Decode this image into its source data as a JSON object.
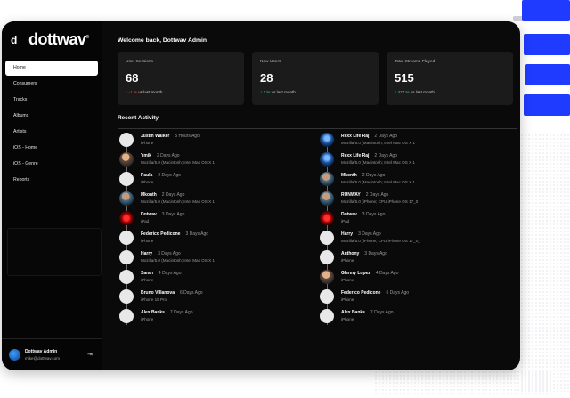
{
  "app": {
    "logo_text": "dottwav",
    "logo_mark": "d",
    "logo_reg": "®"
  },
  "sidebar": {
    "items": [
      {
        "label": "Home",
        "active": true
      },
      {
        "label": "Consumers"
      },
      {
        "label": "Tracks"
      },
      {
        "label": "Albums"
      },
      {
        "label": "Artists"
      },
      {
        "label": "iOS - Home"
      },
      {
        "label": "iOS - Genre"
      },
      {
        "label": "Reports"
      }
    ],
    "user": {
      "name": "Dottwav Admin",
      "email": "mike@dottwav.com",
      "logout_icon": "logout-icon"
    }
  },
  "main": {
    "welcome": "Welcome back, Dottwav Admin",
    "cards": [
      {
        "label": "User Sessions",
        "value": "68",
        "trend_arrow": "↓",
        "trend_value": "-1 %",
        "trend_text": "vs last month",
        "trend": "down"
      },
      {
        "label": "New Users",
        "value": "28",
        "trend_arrow": "↑",
        "trend_value": "1 %",
        "trend_text": "vs last month",
        "trend": "up"
      },
      {
        "label": "Total Streams Played",
        "value": "515",
        "trend_arrow": "↑",
        "trend_value": "477 %",
        "trend_text": "vs last month",
        "trend": "up"
      }
    ],
    "recent_title": "Recent Activity",
    "activity_left": [
      {
        "name": "Justin Walker",
        "time": "5 Hours Ago",
        "device": "iPhone",
        "avatar": "blank"
      },
      {
        "name": "Ymik",
        "time": "2 Days Ago",
        "device": "Mozilla/5.0 (Macintosh; Intel Mac OS X 1",
        "avatar": "photo"
      },
      {
        "name": "Paula",
        "time": "2 Days Ago",
        "device": "iPhone",
        "avatar": "blank"
      },
      {
        "name": "Mkonth",
        "time": "2 Days Ago",
        "device": "Mozilla/5.0 (Macintosh; Intel Mac OS X 1",
        "avatar": "photo2"
      },
      {
        "name": "Dotwav",
        "time": "3 Days Ago",
        "device": "iPad",
        "avatar": "red"
      },
      {
        "name": "Federico Pedicone",
        "time": "3 Days Ago",
        "device": "iPhone",
        "avatar": "blank"
      },
      {
        "name": "Harry",
        "time": "3 Days Ago",
        "device": "Mozilla/5.0 (Macintosh; Intel Mac OS X 1",
        "avatar": "blank"
      },
      {
        "name": "Sarah",
        "time": "4 Days Ago",
        "device": "iPhone",
        "avatar": "blank"
      },
      {
        "name": "Bruno Villanova",
        "time": "6 Days Ago",
        "device": "iPhone 15 Pro",
        "avatar": "blank"
      },
      {
        "name": "Alex Banks",
        "time": "7 Days Ago",
        "device": "iPhone",
        "avatar": "blank"
      }
    ],
    "activity_right": [
      {
        "name": "Rexx Life Raj",
        "time": "2 Days Ago",
        "device": "Mozilla/5.0 (Macintosh; Intel Mac OS X 1",
        "avatar": "blue2"
      },
      {
        "name": "Rexx Life Raj",
        "time": "2 Days Ago",
        "device": "Mozilla/5.0 (Macintosh; Intel Mac OS X 1",
        "avatar": "blue2"
      },
      {
        "name": "Mkonth",
        "time": "2 Days Ago",
        "device": "Mozilla/5.0 (Macintosh; Intel Mac OS X 1",
        "avatar": "photo2"
      },
      {
        "name": "RUNWAY",
        "time": "2 Days Ago",
        "device": "Mozilla/5.0 (iPhone; CPU iPhone OS 17_0",
        "avatar": "photo2"
      },
      {
        "name": "Dotwav",
        "time": "3 Days Ago",
        "device": "iPad",
        "avatar": "red"
      },
      {
        "name": "Harry",
        "time": "3 Days Ago",
        "device": "Mozilla/5.0 (iPhone; CPU iPhone OS 17_0_",
        "avatar": "blank"
      },
      {
        "name": "Anthony",
        "time": "3 Days Ago",
        "device": "iPhone",
        "avatar": "blank"
      },
      {
        "name": "Glenny Lopez",
        "time": "4 Days Ago",
        "device": "iPhone",
        "avatar": "photo"
      },
      {
        "name": "Federico Pedicone",
        "time": "6 Days Ago",
        "device": "iPhone",
        "avatar": "blank"
      },
      {
        "name": "Alex Banks",
        "time": "7 Days Ago",
        "device": "iPhone",
        "avatar": "blank"
      }
    ]
  },
  "colors": {
    "accent_blue": "#1f3bff",
    "trend_up": "#3ddc84",
    "trend_down": "#ff4a4a"
  }
}
